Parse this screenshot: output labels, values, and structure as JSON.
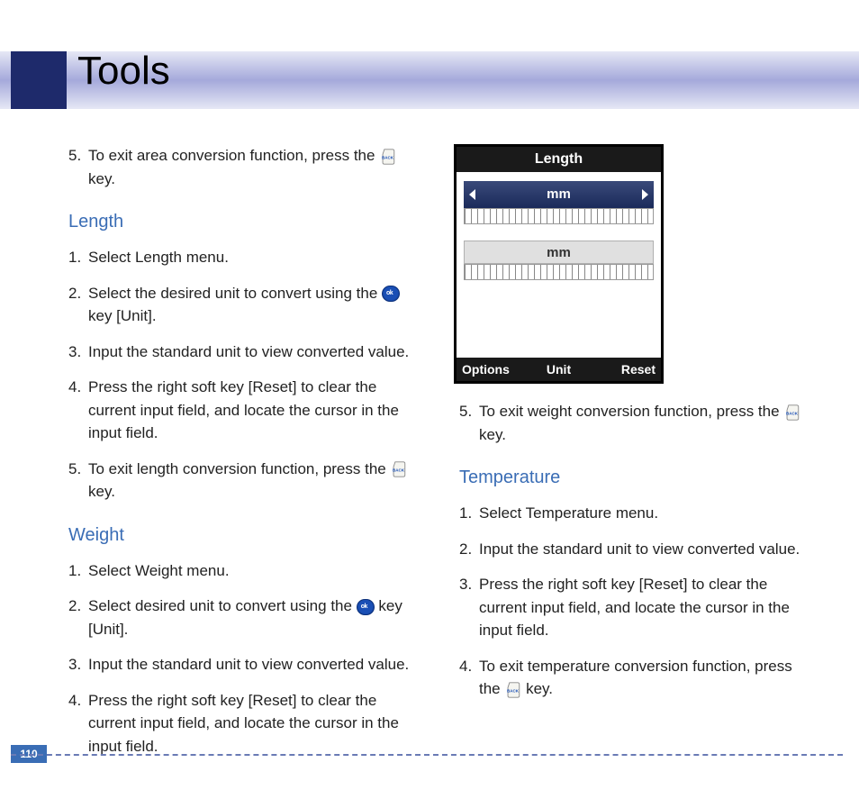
{
  "page_title": "Tools",
  "page_number": "110",
  "col1": {
    "item5_pre": "To exit area conversion function, press the ",
    "item5_post": " key.",
    "length_heading": "Length",
    "len1": "Select Length menu.",
    "len2_pre": "Select the desired unit to convert using the ",
    "len2_post": " key [Unit].",
    "len3": "Input the standard unit to view converted value.",
    "len4": "Press the right soft key [Reset] to clear the current input field, and locate the cursor in the input field.",
    "len5_pre": "To exit length conversion function, press the ",
    "len5_post": " key.",
    "weight_heading": "Weight",
    "wt1": "Select Weight menu.",
    "wt2_pre": "Select desired unit to convert using the ",
    "wt2_post": " key [Unit].",
    "wt3": "Input the standard unit to view converted value.",
    "wt4": "Press the right soft key [Reset] to clear the current input field, and locate the cursor in the input field."
  },
  "col2": {
    "w5_pre": "To exit weight conversion function, press the ",
    "w5_post": " key.",
    "temp_heading": "Temperature",
    "t1": "Select Temperature menu.",
    "t2": "Input the standard unit to view converted value.",
    "t3": "Press the right soft key [Reset] to clear the current input field, and locate the cursor in the input field.",
    "t4_pre": "To exit temperature conversion function, press  the ",
    "t4_post": " key."
  },
  "phone": {
    "title": "Length",
    "unit_selector": "mm",
    "unit_static": "mm",
    "softkey_left": "Options",
    "softkey_center": "Unit",
    "softkey_right": "Reset"
  }
}
